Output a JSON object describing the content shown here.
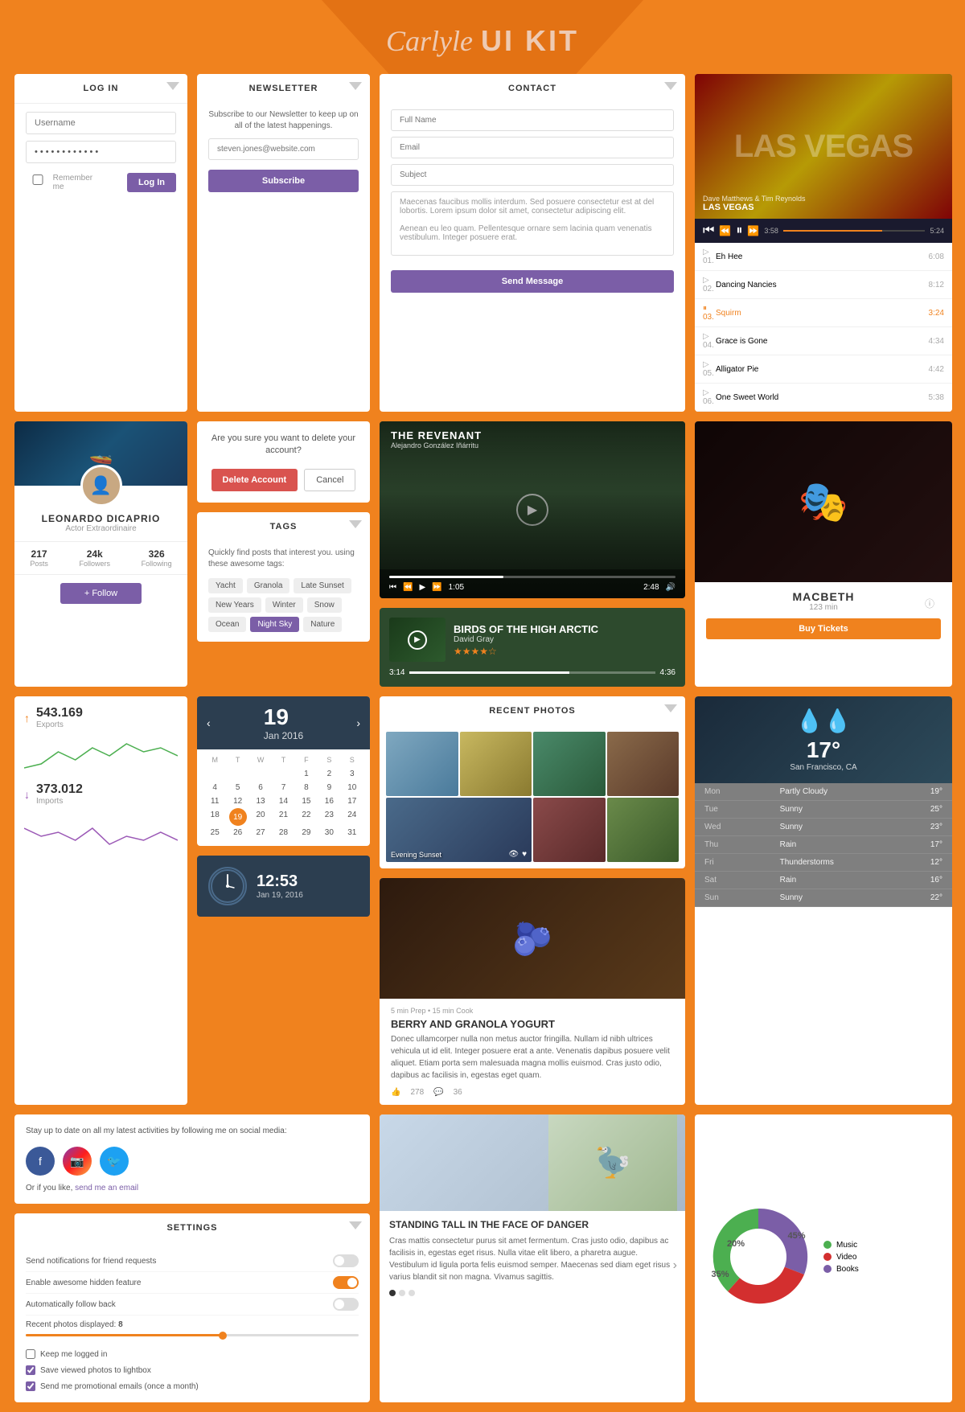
{
  "header": {
    "title_cursive": "Carlyle",
    "title_bold": "UI KIT"
  },
  "login": {
    "heading": "LOG IN",
    "username_placeholder": "Username",
    "password_value": "••••••••••••",
    "remember_label": "Remember me",
    "login_btn": "Log In"
  },
  "newsletter": {
    "heading": "NEWSLETTER",
    "description": "Subscribe to our Newsletter to keep up on all of the latest happenings.",
    "email_placeholder": "steven.jones@website.com",
    "subscribe_btn": "Subscribe"
  },
  "contact": {
    "heading": "CONTACT",
    "fullname_placeholder": "Full Name",
    "email_placeholder": "Email",
    "subject_placeholder": "Subject",
    "message_text": "Maecenas faucibus mollis interdum. Sed posuere consectetur est at del lobortis. Lorem ipsum dolor sit amet, consectetur adipiscing elit.\n\nAenean eu leo quam. Pellentesque ornare sem lacinia quam venenatis vestibulum. Integer posuere erat.",
    "send_btn": "Send Message"
  },
  "delete_account": {
    "question": "Are you sure you want to delete your account?",
    "delete_btn": "Delete Account",
    "cancel_btn": "Cancel"
  },
  "tags": {
    "heading": "TAGS",
    "description": "Quickly find posts that interest you. using these awesome tags:",
    "tags": [
      "Yacht",
      "Granola",
      "Late Sunset",
      "New Years",
      "Winter",
      "Snow",
      "Ocean",
      "Night Sky",
      "Nature"
    ],
    "active_tag": "Night Sky"
  },
  "profile": {
    "name": "LEONARDO DICAPRIO",
    "title": "Actor Extraordinaire",
    "posts": "217",
    "posts_label": "Posts",
    "followers": "24k",
    "followers_label": "Followers",
    "following": "326",
    "following_label": "Following",
    "follow_btn": "+ Follow"
  },
  "video": {
    "title": "THE REVENANT",
    "subtitle": "Alejandro González Iñárritu",
    "time_current": "1:05",
    "time_total": "2:48",
    "volume_icon": "🔊"
  },
  "birds": {
    "title": "BIRDS OF THE HIGH ARCTIC",
    "author": "David Gray",
    "stars": "★★★★☆",
    "time_current": "3:14",
    "time_total": "4:36"
  },
  "music_player": {
    "artist": "Dave Matthews & Tim Reynolds",
    "album": "LAS VEGAS",
    "time_current": "3:58",
    "time_total": "5:24",
    "tracks": [
      {
        "num": "01.",
        "name": "Eh Hee",
        "duration": "6:08"
      },
      {
        "num": "02.",
        "name": "Dancing Nancies",
        "duration": "8:12"
      },
      {
        "num": "03.",
        "name": "Squirm",
        "duration": "3:24",
        "active": true
      },
      {
        "num": "04.",
        "name": "Grace is Gone",
        "duration": "4:34"
      },
      {
        "num": "05.",
        "name": "Alligator Pie",
        "duration": "4:42"
      },
      {
        "num": "06.",
        "name": "One Sweet World",
        "duration": "5:38"
      }
    ]
  },
  "recent_photos": {
    "heading": "RECENT PHOTOS",
    "caption": "Evening Sunset"
  },
  "analytics": {
    "exports_value": "543.169",
    "exports_label": "Exports",
    "imports_value": "373.012",
    "imports_label": "Imports"
  },
  "calendar": {
    "day": "19",
    "month_year": "Jan 2016",
    "day_headers": [
      "M",
      "T",
      "W",
      "T",
      "F",
      "S",
      "S"
    ],
    "days": [
      "",
      "",
      "",
      "",
      "1",
      "2",
      "3",
      "4",
      "5",
      "6",
      "7",
      "8",
      "9",
      "10",
      "11",
      "12",
      "13",
      "14",
      "15",
      "16",
      "17",
      "18",
      "19",
      "20",
      "21",
      "22",
      "23",
      "24",
      "25",
      "26",
      "27",
      "28",
      "29",
      "30",
      "31"
    ],
    "today": "19"
  },
  "clock": {
    "time": "12:53",
    "date": "Jan 19, 2016"
  },
  "weather": {
    "temperature": "17°",
    "location": "San Francisco, CA",
    "forecast": [
      {
        "day": "Mon",
        "condition": "Partly Cloudy",
        "temp": "19°"
      },
      {
        "day": "Tue",
        "condition": "Sunny",
        "temp": "25°"
      },
      {
        "day": "Wed",
        "condition": "Sunny",
        "temp": "23°"
      },
      {
        "day": "Thu",
        "condition": "Rain",
        "temp": "17°"
      },
      {
        "day": "Fri",
        "condition": "Thunderstorms",
        "temp": "12°"
      },
      {
        "day": "Sat",
        "condition": "Rain",
        "temp": "16°"
      },
      {
        "day": "Sun",
        "condition": "Sunny",
        "temp": "22°"
      }
    ]
  },
  "food": {
    "meta": "5 min Prep • 15 min Cook",
    "title": "BERRY AND GRANOLA YOGURT",
    "description": "Donec ullamcorper nulla non metus auctor fringilla. Nullam id nibh ultrices vehicula ut id elit. Integer posuere erat a ante. Venenatis dapibus posuere velit aliquet. Etiam porta sem malesuada magna mollis euismod. Cras justo odio, dapibus ac facilisis in, egestas eget quam.",
    "likes": "278",
    "comments": "36"
  },
  "social": {
    "description": "Stay up to date on all my latest activities by following me on social media:",
    "email_prefix": "Or if you like,",
    "email_link": "send me an email"
  },
  "settings": {
    "heading": "SETTINGS",
    "options": [
      {
        "label": "Send notifications for friend requests",
        "type": "toggle",
        "on": false
      },
      {
        "label": "Enable awesome hidden feature",
        "type": "toggle",
        "on": true
      },
      {
        "label": "Automatically follow back",
        "type": "toggle",
        "on": false
      }
    ],
    "slider_label": "Recent photos displayed:",
    "slider_value": "8",
    "checkboxes": [
      {
        "label": "Keep me logged in",
        "checked": false
      },
      {
        "label": "Save viewed photos to lightbox",
        "checked": true
      },
      {
        "label": "Send me promotional emails (once a month)",
        "checked": true
      }
    ]
  },
  "article": {
    "title": "STANDING TALL IN THE FACE OF DANGER",
    "description": "Cras mattis consectetur purus sit amet fermentum. Cras justo odio, dapibus ac facilisis in, egestas eget risus. Nulla vitae elit libero, a pharetra augue.\n\nVestibulum id ligula porta felis euismod semper. Maecenas sed diam eget risus varius blandit sit non magna. Vivamus sagittis."
  },
  "pie_chart": {
    "segments": [
      {
        "label": "Music",
        "percent": 20,
        "color": "#4caf50"
      },
      {
        "label": "Video",
        "percent": 35,
        "color": "#d32f2f"
      },
      {
        "label": "Books",
        "percent": 45,
        "color": "#7B5EA7"
      }
    ]
  },
  "macbeth": {
    "title": "MACBETH",
    "duration": "123 min",
    "buy_btn": "Buy Tickets"
  }
}
